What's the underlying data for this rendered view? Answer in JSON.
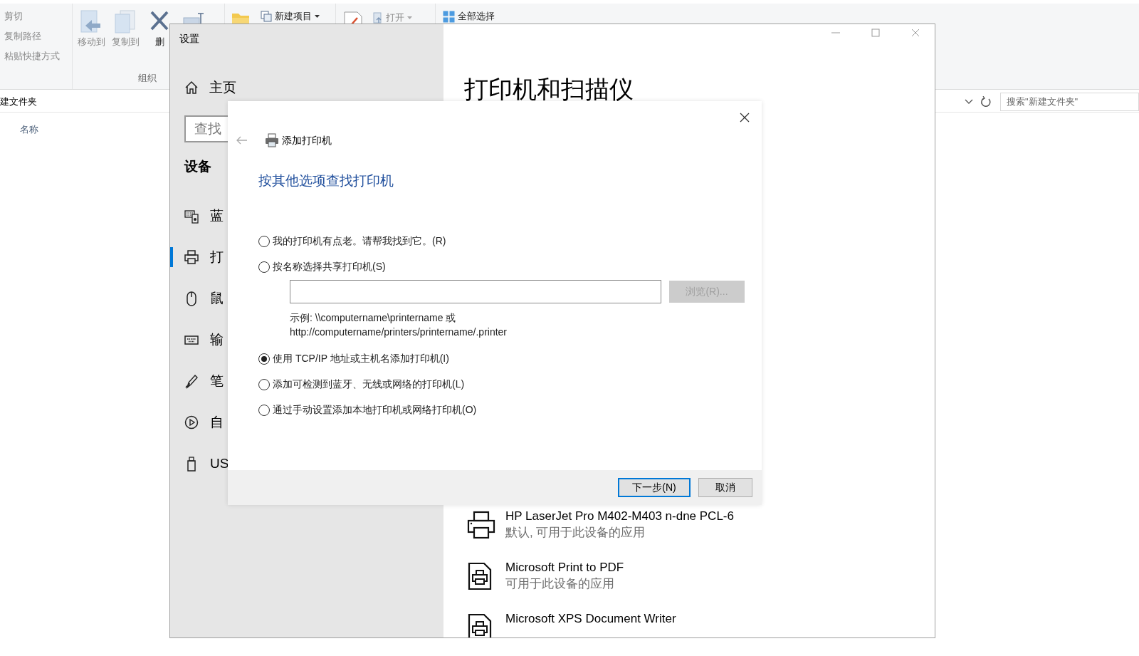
{
  "explorer": {
    "ribbon": {
      "clipboard": [
        {
          "label": "剪切",
          "disabled": true
        },
        {
          "label": "复制路径",
          "disabled": true
        },
        {
          "label": "粘贴快捷方式",
          "disabled": true
        }
      ],
      "organize": {
        "buttons": [
          {
            "label": "移动到",
            "disabled": true
          },
          {
            "label": "复制到",
            "disabled": true
          },
          {
            "label": "删",
            "disabled": false
          }
        ],
        "label": "组织"
      },
      "new_item": {
        "label": "新建项目",
        "disabled": false
      },
      "open": {
        "label": "打开",
        "disabled": true
      },
      "select_all": {
        "label": "全部选择",
        "disabled": false
      }
    },
    "address": "建文件夹",
    "search": {
      "placeholder": "搜索\"新建文件夹\""
    },
    "column_header": "名称"
  },
  "settings": {
    "title": "设置",
    "home": "主页",
    "search": {
      "placeholder": "查找"
    },
    "section": "设备",
    "nav": [
      {
        "label": "蓝",
        "selected": false
      },
      {
        "label": "打",
        "selected": true
      },
      {
        "label": "鼠",
        "selected": false
      },
      {
        "label": "输",
        "selected": false
      },
      {
        "label": "笔",
        "selected": false
      },
      {
        "label": "自",
        "selected": false
      },
      {
        "label": "US",
        "selected": false
      }
    ],
    "heading": "打印机和扫描仪",
    "printers": [
      {
        "kind": "printer",
        "name": "HP LaserJet Pro M402-M403 n-dne PCL-6",
        "status": "默认, 可用于此设备的应用"
      },
      {
        "kind": "file",
        "name": "Microsoft Print to PDF",
        "status": "可用于此设备的应用"
      },
      {
        "kind": "file",
        "name": "Microsoft XPS Document Writer"
      }
    ]
  },
  "dialog": {
    "title": "添加打印机",
    "heading": "按其他选项查找打印机",
    "options": [
      {
        "label": "我的打印机有点老。请帮我找到它。(R)",
        "selected": false
      },
      {
        "label": "按名称选择共享打印机(S)",
        "selected": false,
        "field": {
          "browse": {
            "label": "浏览(R)...",
            "disabled": true
          },
          "example": [
            "示例: \\\\computername\\printername 或",
            "http://computername/printers/printername/.printer"
          ]
        }
      },
      {
        "label": "使用 TCP/IP 地址或主机名添加打印机(I)",
        "selected": true
      },
      {
        "label": "添加可检测到蓝牙、无线或网络的打印机(L)",
        "selected": false
      },
      {
        "label": "通过手动设置添加本地打印机或网络打印机(O)",
        "selected": false
      }
    ],
    "buttons": [
      {
        "label": "下一步(N)",
        "default": true
      },
      {
        "label": "取消",
        "default": false
      }
    ]
  }
}
